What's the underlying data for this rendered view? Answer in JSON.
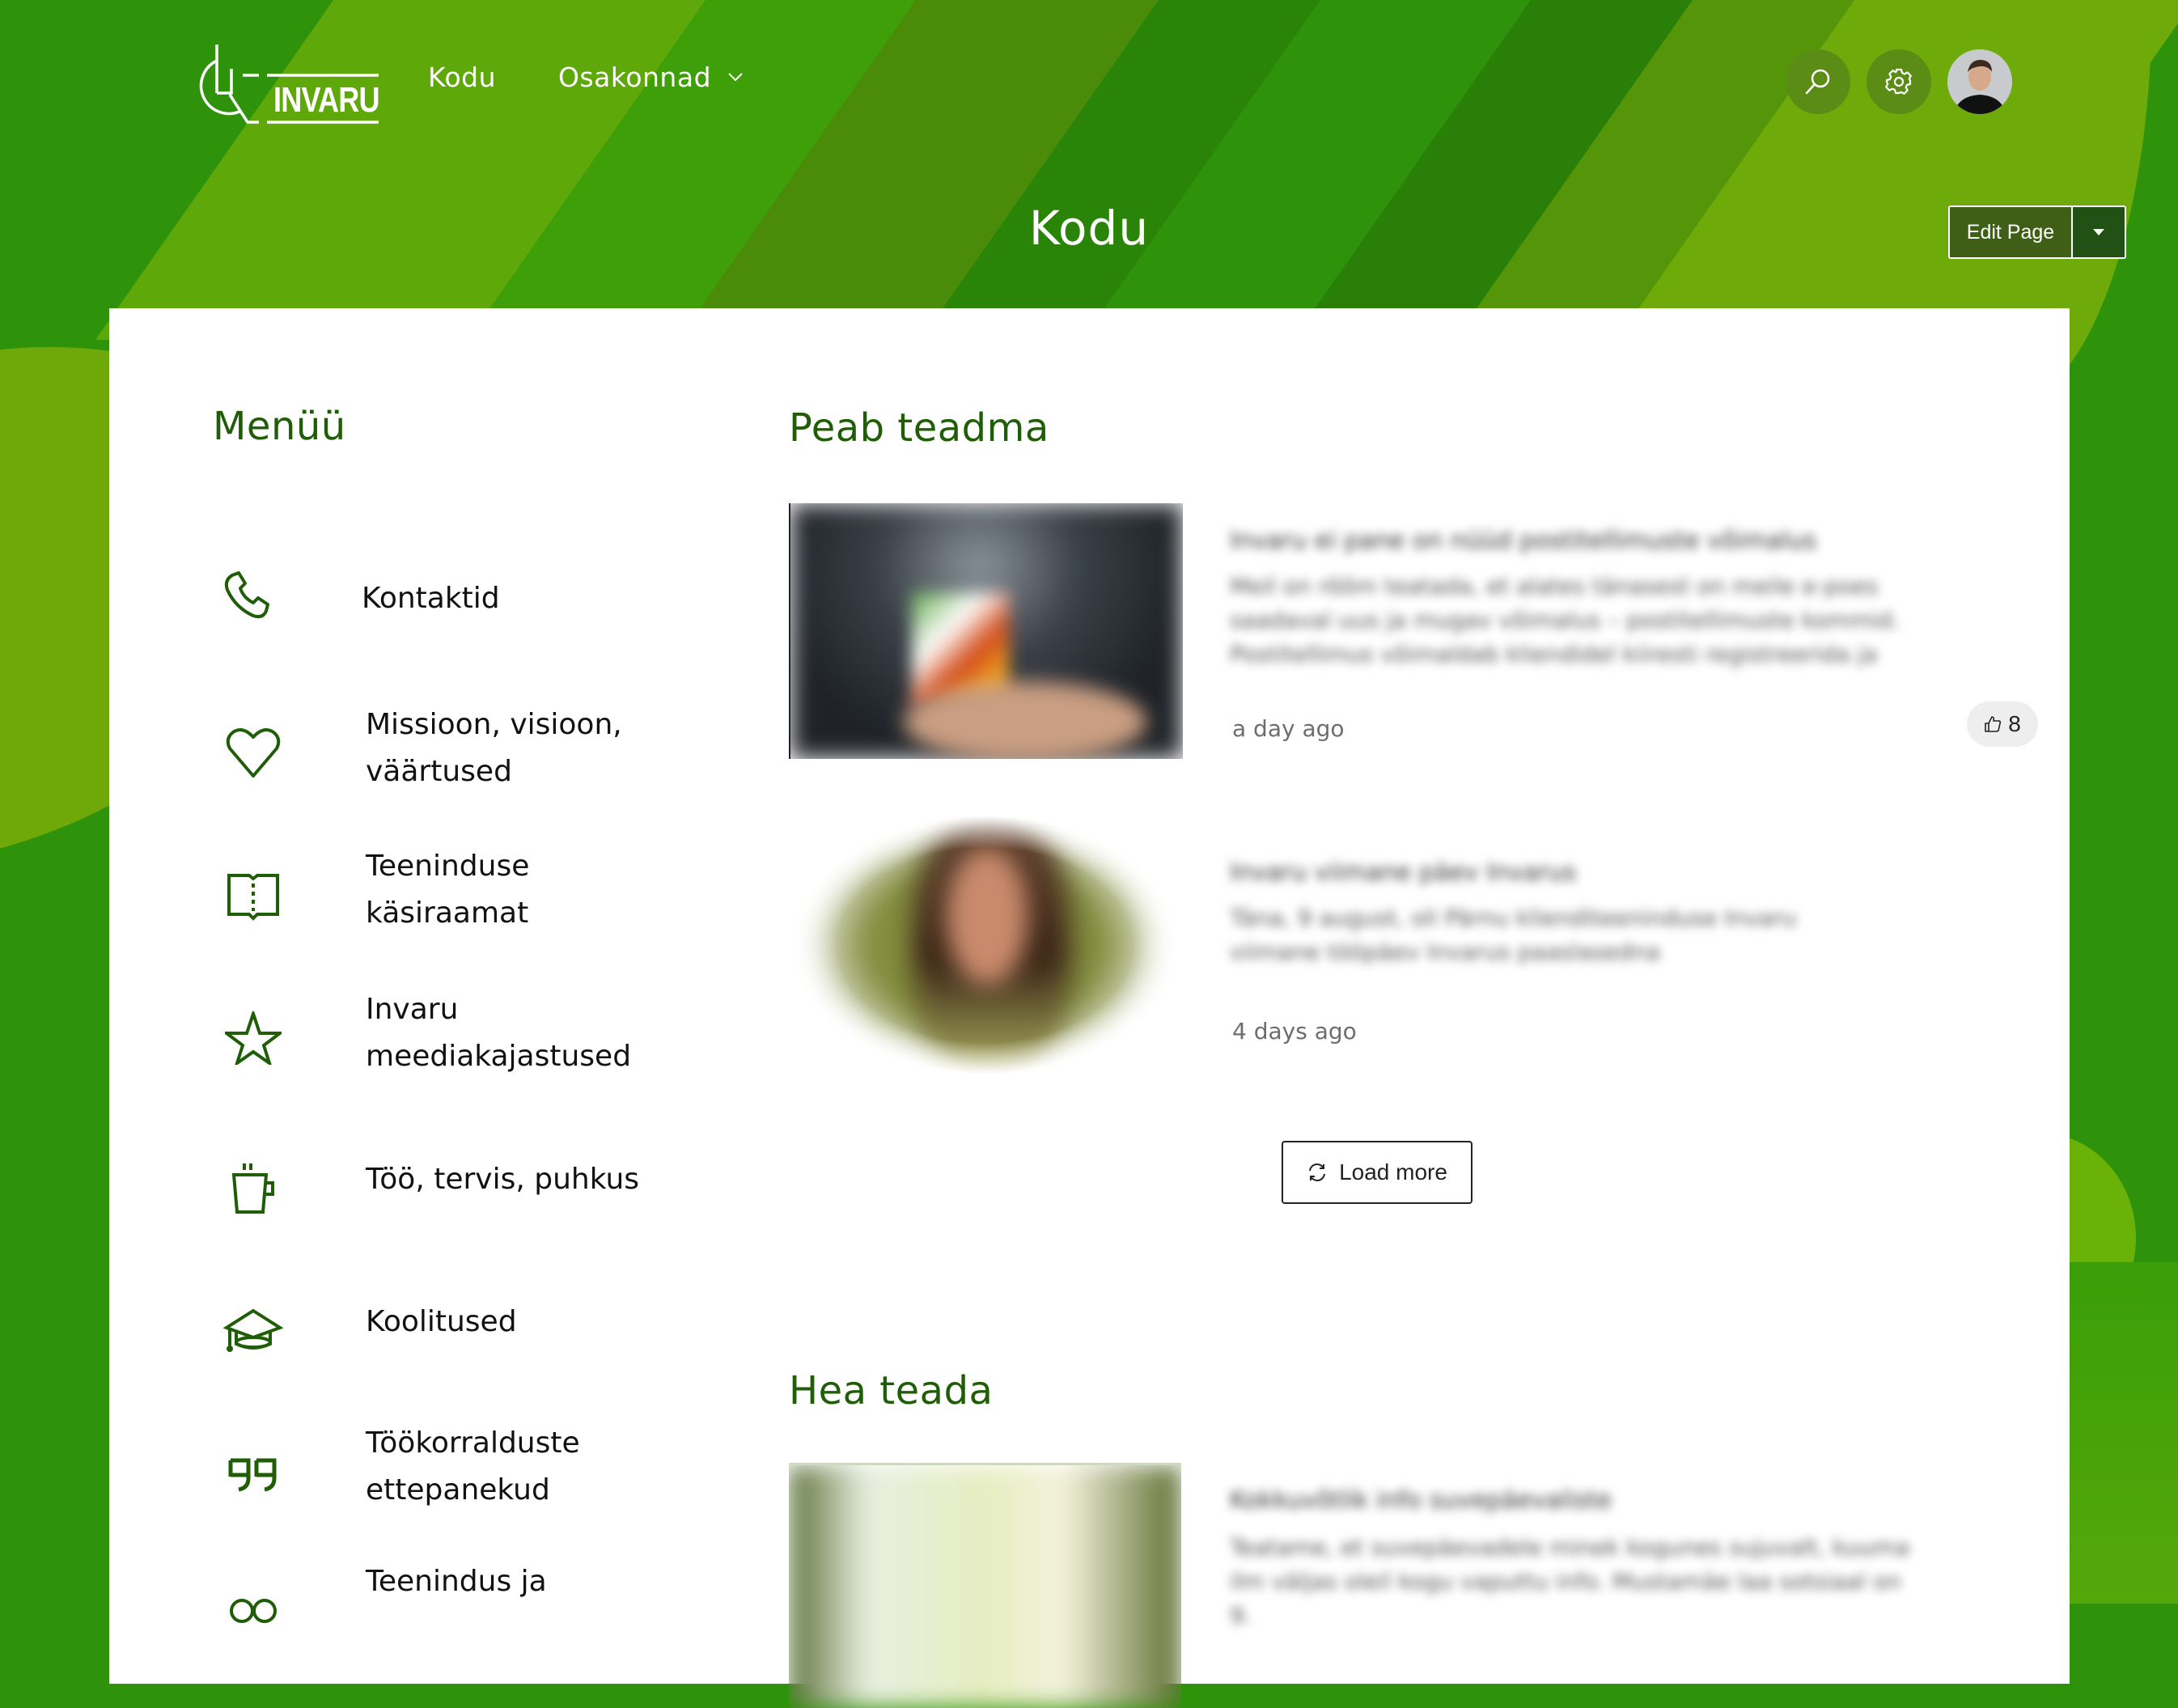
{
  "brand": {
    "logo_text": "INVARU"
  },
  "nav": {
    "items": [
      {
        "label": "Kodu"
      },
      {
        "label": "Osakonnad",
        "has_dropdown": true
      }
    ]
  },
  "header_actions": {
    "search_icon": "search-icon",
    "settings_icon": "gear-icon",
    "avatar_alt": "User avatar"
  },
  "page": {
    "title": "Kodu",
    "edit_button_label": "Edit Page"
  },
  "menu": {
    "heading": "Menüü",
    "items": [
      {
        "label": "Kontaktid",
        "icon": "phone-icon"
      },
      {
        "label": "Missioon, visioon, väärtused",
        "icon": "heart-icon"
      },
      {
        "label": "Teeninduse käsiraamat",
        "icon": "book-icon"
      },
      {
        "label": "Invaru meediakajastused",
        "icon": "star-icon"
      },
      {
        "label": "Töö, tervis, puhkus",
        "icon": "mug-icon"
      },
      {
        "label": "Koolitused",
        "icon": "graduation-cap-icon"
      },
      {
        "label": "Töökorralduste ettepanekud",
        "icon": "quote-icon"
      },
      {
        "label": "Teenindus ja",
        "icon": "people-icon"
      }
    ]
  },
  "must_know": {
    "heading": "Peab teadma",
    "posts": [
      {
        "title": "Invaru ei pane on nüüd postitellimuste võimalus",
        "excerpt": "Meil on rõõm teatada, et alates tänasest on meile e-poes saadaval uus ja mugav võimalus – postitellimuste kommid. Postitellimus võimaldab kliendidel kiiresti registreerida ja",
        "time": "a day ago",
        "likes": "8"
      },
      {
        "title": "Invaru viimane päev Invarus",
        "excerpt": "Täna, 9 august, oli Pärnu klienditeeninduse Invaru viimane tööpäev Invarus paaslasedna",
        "time": "4 days ago",
        "likes": null
      }
    ],
    "load_more_label": "Load more"
  },
  "good_to_know": {
    "heading": "Hea teada",
    "posts": [
      {
        "title": "Kokkuvõtlik info suvepäevaliste",
        "excerpt": "Teatame, et suvepäevadele minek kogunes sujuvalt, kuuma ilm väljas oleil kogu vaputtu info. Mustamäe laa sotsiaal on 9."
      }
    ]
  },
  "colors": {
    "brand_dark": "#2e930a",
    "brand_light": "#6ea909",
    "heading_green": "#1f5e07",
    "edit_button_bg": "#3f5f16",
    "circle_button_bg": "#5a8c16"
  }
}
